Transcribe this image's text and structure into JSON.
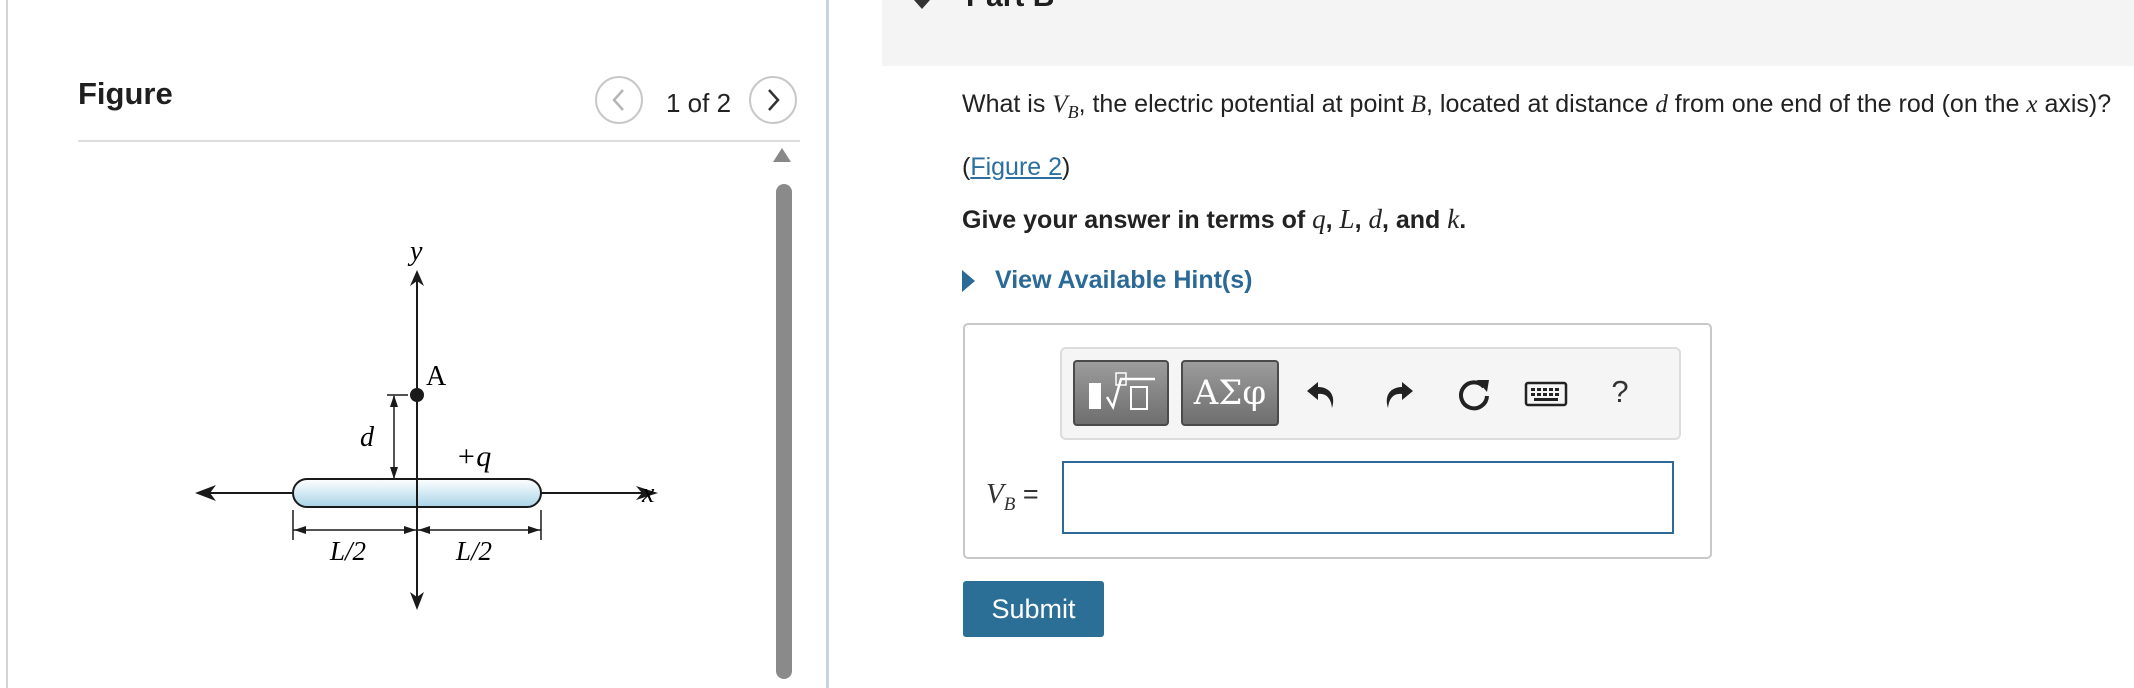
{
  "figure_panel": {
    "title": "Figure",
    "page_indicator": "1 of 2",
    "prev_icon": "chevron-left-icon",
    "next_icon": "chevron-right-icon",
    "diagram": {
      "label_y": "y",
      "label_x": "x",
      "label_A": "A",
      "label_d": "d",
      "label_charge": "+q",
      "label_left_half": "L/2",
      "label_right_half": "L/2"
    }
  },
  "part": {
    "title": "Part B"
  },
  "question": {
    "text_1": "What is ",
    "var_V": "V",
    "var_sub_B": "B",
    "text_2": ", the electric potential at point ",
    "var_B": "B",
    "text_3": ", located at distance ",
    "var_d": "d",
    "text_4": " from one end of the rod (on the ",
    "var_x": "x",
    "text_5": " axis)?",
    "figure_link_open": "(",
    "figure_link": "Figure 2",
    "figure_link_close": ")"
  },
  "instruction": {
    "prefix": "Give your answer in terms of ",
    "var_q": "q",
    "sep1": ", ",
    "var_L": "L",
    "sep2": ", ",
    "var_d": "d",
    "sep3": ", and ",
    "var_k": "k",
    "suffix": "."
  },
  "hint": {
    "label": "View Available Hint(s)"
  },
  "toolbar": {
    "templates_icon": "math-templates-icon",
    "symbols_label": "ΑΣφ",
    "undo_icon": "undo-icon",
    "redo_icon": "redo-icon",
    "reset_icon": "reset-icon",
    "keyboard_icon": "keyboard-icon",
    "help_label": "?"
  },
  "answer": {
    "label_var": "V",
    "label_sub": "B",
    "label_eq": " =",
    "value": ""
  },
  "submit_label": "Submit",
  "colors": {
    "accent": "#2b6f96",
    "rod_fill_top": "#ffffff",
    "rod_fill_bottom": "#a8d4e8"
  }
}
